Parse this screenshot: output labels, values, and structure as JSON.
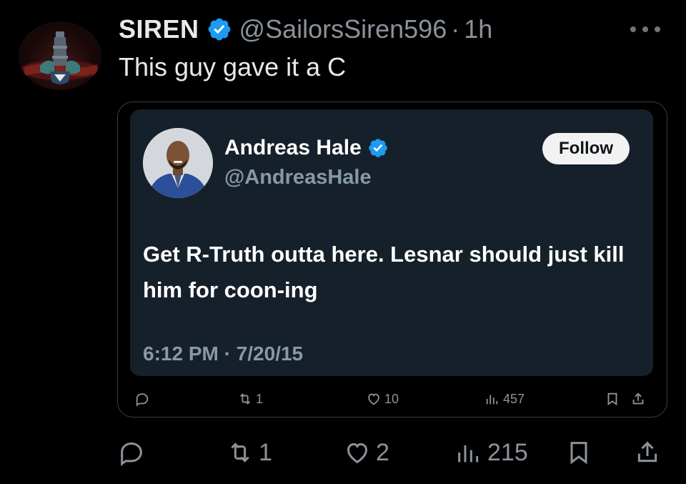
{
  "post": {
    "author_name": "SIREN",
    "author_handle": "@SailorsSiren596",
    "separator": "·",
    "time": "1h",
    "text": "This guy gave it a C",
    "more_icon": "ellipsis-icon",
    "verified_color": "#1d9bf0"
  },
  "quoted_image": {
    "author_name": "Andreas Hale",
    "author_handle": "@AndreasHale",
    "follow_label": "Follow",
    "body": "Get R-Truth outta here. Lesnar should just kill him for coon-ing",
    "date": "6:12 PM · 7/20/15",
    "actions": {
      "reply_icon": "reply-icon",
      "retweets": "1",
      "likes": "10",
      "views": "457",
      "bookmark_icon": "bookmark-icon",
      "share_icon": "share-icon"
    }
  },
  "actions": {
    "reply_icon": "reply-icon",
    "retweets": "1",
    "likes": "2",
    "views": "215",
    "bookmark_icon": "bookmark-icon",
    "share_icon": "share-icon"
  }
}
